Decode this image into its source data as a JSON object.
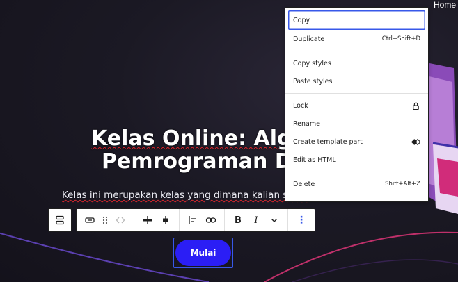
{
  "nav": {
    "home_label": "Home"
  },
  "hero": {
    "title_line1_visible": "Kelas Online: Algor",
    "title_line2_visible": "Pemrograman Da",
    "subtitle_visible": "Kelas ini merupakan kelas yang dimana kalian semu",
    "button_label": "Mulai"
  },
  "toolbar": {
    "icons": [
      "block-parent-icon",
      "button-block-icon",
      "drag-handle-icon",
      "move-arrows-icon",
      "justify-center-icon",
      "justify-stretch-icon",
      "align-left-icon",
      "link-icon",
      "bold-icon",
      "italic-icon",
      "chevron-down-icon",
      "more-options-icon"
    ],
    "bold_glyph": "B",
    "italic_glyph": "I",
    "more_glyph": "⋮"
  },
  "context_menu": {
    "groups": [
      [
        {
          "label": "Copy",
          "shortcut": ""
        },
        {
          "label": "Duplicate",
          "shortcut": "Ctrl+Shift+D"
        }
      ],
      [
        {
          "label": "Copy styles",
          "shortcut": ""
        },
        {
          "label": "Paste styles",
          "shortcut": ""
        }
      ],
      [
        {
          "label": "Lock",
          "icon": "lock-icon"
        },
        {
          "label": "Rename"
        },
        {
          "label": "Create template part",
          "icon": "template-part-icon"
        },
        {
          "label": "Edit as HTML"
        }
      ],
      [
        {
          "label": "Delete",
          "shortcut": "Shift+Alt+Z"
        }
      ]
    ]
  },
  "colors": {
    "accent": "#3858e9",
    "button_bg": "#2b1ef5",
    "background": "#1b1924"
  }
}
